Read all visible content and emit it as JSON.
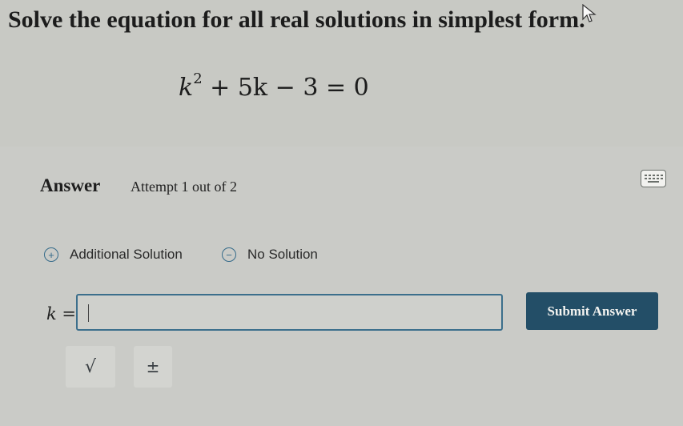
{
  "question": {
    "prompt": "Solve the equation for all real solutions in simplest form.",
    "equation": {
      "variable": "k",
      "exponent": "2",
      "rest": " + 5k − 3 = 0"
    }
  },
  "answer": {
    "title": "Answer",
    "attempt": "Attempt 1 out of 2",
    "options": [
      {
        "label": "Additional Solution",
        "icon": "plus-circle-icon"
      },
      {
        "label": "No Solution",
        "icon": "minus-circle-icon"
      }
    ],
    "input": {
      "label_var": "k",
      "label_eq": " =",
      "value": ""
    },
    "submit_label": "Submit Answer",
    "tools": [
      {
        "symbol": "√",
        "icon": "square-root-icon"
      },
      {
        "symbol": "±",
        "icon": "plus-minus-icon"
      }
    ]
  },
  "colors": {
    "accent": "#234e67",
    "background": "#c9cbc6"
  }
}
